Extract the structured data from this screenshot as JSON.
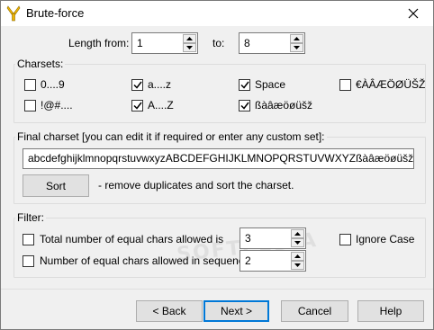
{
  "window": {
    "title": "Brute-force",
    "app_icon": "yellow-key-icon"
  },
  "length": {
    "from_label": "Length from:",
    "from_value": "1",
    "to_label": "to:",
    "to_value": "8"
  },
  "charsets": {
    "title": "Charsets:",
    "items": [
      {
        "label": "0....9",
        "checked": false
      },
      {
        "label": "a....z",
        "checked": true
      },
      {
        "label": "Space",
        "checked": true
      },
      {
        "label": "€ÀÂÆÖØÜŠŽ",
        "checked": false
      },
      {
        "label": "!@#....",
        "checked": false
      },
      {
        "label": "A....Z",
        "checked": true
      },
      {
        "label": "ßàâæöøüšž",
        "checked": true
      }
    ]
  },
  "final_charset": {
    "title": "Final charset [you can edit it if required or enter any custom set]:",
    "value": "abcdefghijklmnopqrstuvwxyzABCDEFGHIJKLMNOPQRSTUVWXYZßàâæöøüšž",
    "sort_button": "Sort",
    "sort_hint": "- remove duplicates and sort the charset."
  },
  "filter": {
    "title": "Filter:",
    "total_label": "Total number of equal chars allowed is",
    "total_checked": false,
    "total_value": "3",
    "sequence_label": "Number of equal chars allowed in sequence is",
    "sequence_checked": false,
    "sequence_value": "2",
    "ignore_case_label": "Ignore Case",
    "ignore_case_checked": false
  },
  "buttons": {
    "back": "< Back",
    "next": "Next >",
    "cancel": "Cancel",
    "help": "Help"
  },
  "watermark": "SOFTPEDIA"
}
